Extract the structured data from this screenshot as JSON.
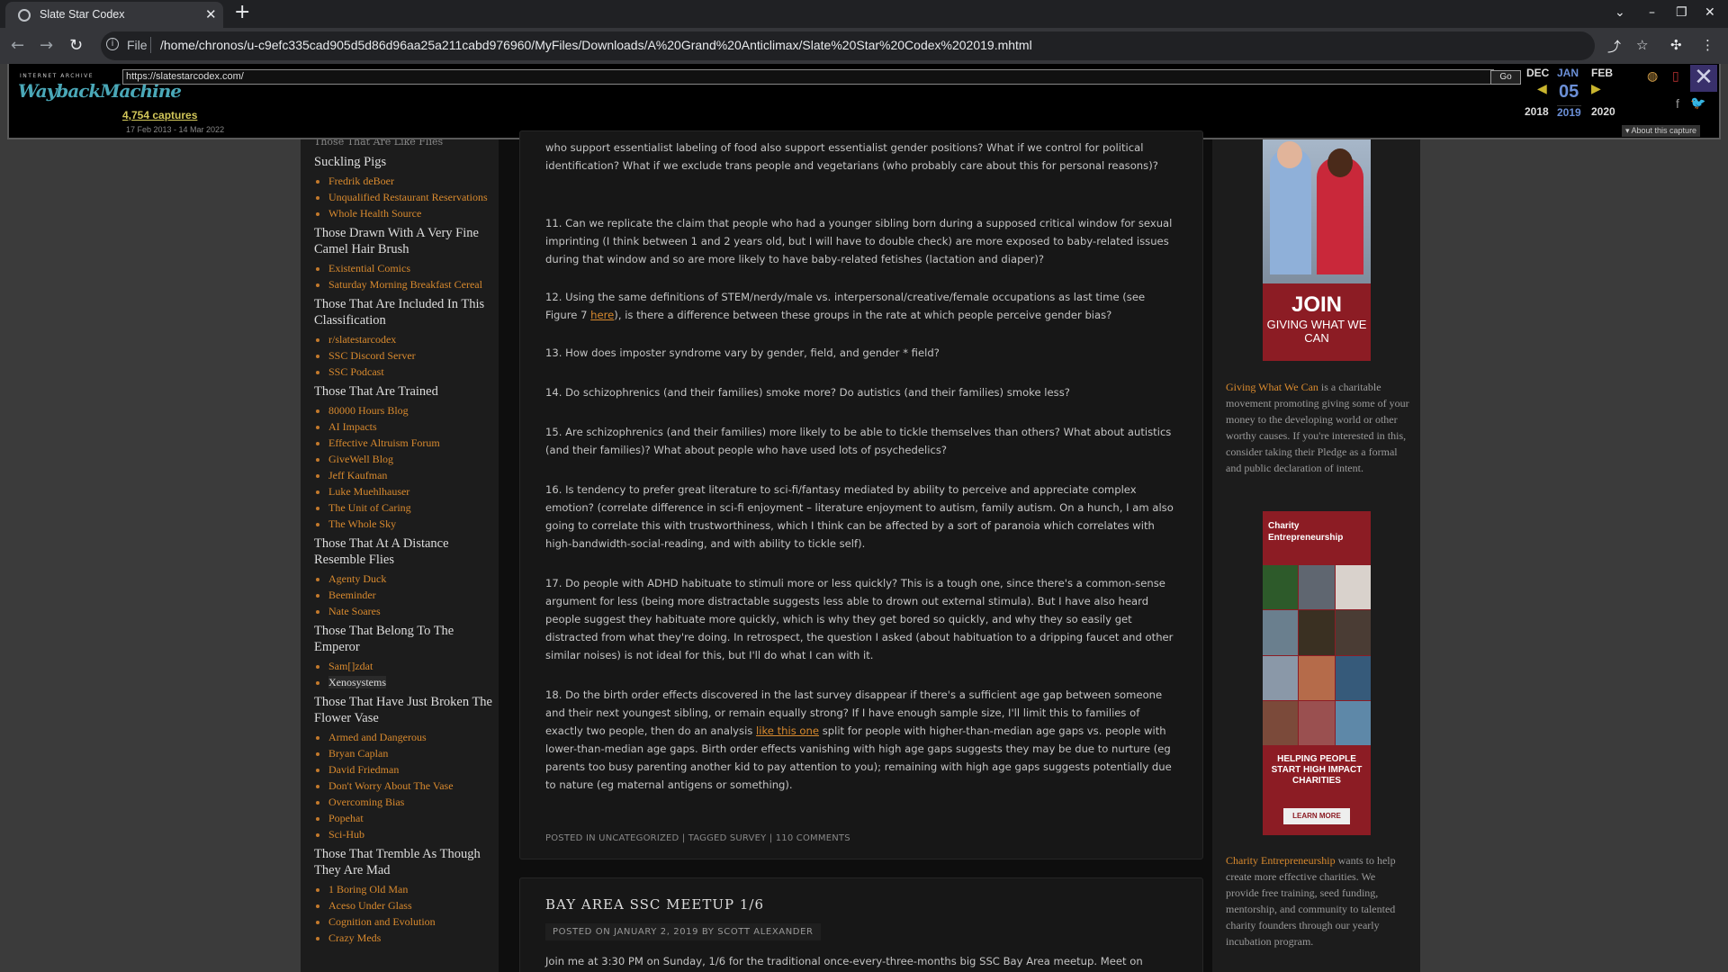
{
  "browser": {
    "tab_title": "Slate Star Codex",
    "url_scheme": "File",
    "url": "/home/chronos/u-c9efc335cad905d5d86d96aa25a211cabd976960/MyFiles/Downloads/A%20Grand%20Anticlimax/Slate%20Star%20Codex%202019.mhtml"
  },
  "wayback": {
    "logo_top": "INTERNET ARCHIVE",
    "logo": "WaybackMachine",
    "url": "https://slatestarcodex.com/",
    "go": "Go",
    "captures": "4,754 captures",
    "range": "17 Feb 2013 - 14 Mar 2022",
    "prev_month": "DEC",
    "cur_month": "JAN",
    "next_month": "FEB",
    "day": "05",
    "prev_year": "2018",
    "cur_year": "2019",
    "next_year": "2020",
    "about": "▾ About this capture",
    "facebook": "f"
  },
  "sidebar": {
    "cut_text": "Those That Are Like Flies",
    "groups": [
      {
        "heading": "Suckling Pigs",
        "items": [
          "Fredrik deBoer",
          "Unqualified Restaurant Reservations",
          "Whole Health Source"
        ]
      },
      {
        "heading": "Those Drawn With A Very Fine Camel Hair Brush",
        "items": [
          "Existential Comics",
          "Saturday Morning Breakfast Cereal"
        ]
      },
      {
        "heading": "Those That Are Included In This Classification",
        "items": [
          "r/slatestarcodex",
          "SSC Discord Server",
          "SSC Podcast"
        ]
      },
      {
        "heading": "Those That Are Trained",
        "items": [
          "80000 Hours Blog",
          "AI Impacts",
          "Effective Altruism Forum",
          "GiveWell Blog",
          "Jeff Kaufman",
          "Luke Muehlhauser",
          "The Unit of Caring",
          "The Whole Sky"
        ]
      },
      {
        "heading": "Those That At A Distance Resemble Flies",
        "items": [
          "Agenty Duck",
          "Beeminder",
          "Nate Soares"
        ]
      },
      {
        "heading": "Those That Belong To The Emperor",
        "items": [
          "Sam[]zdat",
          "Xenosystems"
        ]
      },
      {
        "heading": "Those That Have Just Broken The Flower Vase",
        "items": [
          "Armed and Dangerous",
          "Bryan Caplan",
          "David Friedman",
          "Don't Worry About The Vase",
          "Overcoming Bias",
          "Popehat",
          "Sci-Hub"
        ]
      },
      {
        "heading": "Those That Tremble As Though They Are Mad",
        "items": [
          "1 Boring Old Man",
          "Aceso Under Glass",
          "Cognition and Evolution",
          "Crazy Meds"
        ]
      }
    ]
  },
  "post1": {
    "p_top": "who support essentialist labeling of food also support essentialist gender positions? What if we control for political identification? What if we exclude trans people and vegetarians (who probably care about this for personal reasons)?",
    "p11": "11. Can we replicate the claim that people who had a younger sibling born during a supposed critical window for sexual imprinting (I think between 1 and 2 years old, but I will have to double check) are more exposed to baby-related issues during that window and so are more likely to have baby-related fetishes (lactation and diaper)?",
    "p12_a": "12. Using the same definitions of STEM/nerdy/male vs. interpersonal/creative/female occupations as last time (see Figure 7 ",
    "p12_link": "here",
    "p12_b": "), is there a difference between these groups in the rate at which people perceive gender bias?",
    "p13": "13. How does imposter syndrome vary by gender, field, and gender * field?",
    "p14": "14. Do schizophrenics (and their families) smoke more? Do autistics (and their families) smoke less?",
    "p15": "15. Are schizophrenics (and their families) more likely to be able to tickle themselves than others? What about autistics (and their families)? What about people who have used lots of psychedelics?",
    "p16": "16. Is tendency to prefer great literature to sci-fi/fantasy mediated by ability to perceive and appreciate complex emotion? (correlate difference in sci-fi enjoyment – literature enjoyment to autism, family autism. On a hunch, I am also going to correlate this with trustworthiness, which I think can be affected by a sort of paranoia which correlates with high-bandwidth-social-reading, and with ability to tickle self).",
    "p17": "17. Do people with ADHD habituate to stimuli more or less quickly? This is a tough one, since there's a common-sense argument for less (being more distractable suggests less able to drown out external stimula). But I have also heard people suggest they habituate more quickly, which is why they get bored so quickly, and why they so easily get distracted from what they're doing. In retrospect, the question I asked (about habituation to a dripping faucet and other similar noises) is not ideal for this, but I'll do what I can with it.",
    "p18_a": "18. Do the birth order effects discovered in the last survey disappear if there's a sufficient age gap between someone and their next youngest sibling, or remain equally strong? If I have enough sample size, I'll limit this to families of exactly two people, then do an analysis ",
    "p18_link": "like this one",
    "p18_b": " split for people with higher-than-median age gaps vs. people with lower-than-median age gaps. Birth order effects vanishing with high age gaps suggests they may be due to nurture (eg parents too busy parenting another kid to pay attention to you); remaining with high age gaps suggests potentially due to nature (eg maternal antigens or something).",
    "meta_posted": "POSTED IN ",
    "meta_cat": "UNCATEGORIZED",
    "meta_tagged": " | TAGGED ",
    "meta_tag": "SURVEY",
    "meta_sep": " | ",
    "meta_comments": "110 COMMENTS"
  },
  "post2": {
    "title": "BAY AREA SSC MEETUP 1/6",
    "meta": "POSTED ON JANUARY 2, 2019 BY SCOTT ALEXANDER",
    "text": "Join me at 3:30 PM on Sunday, 1/6 for the traditional once-every-three-months big SSC Bay Area meetup. Meet on"
  },
  "rightbar": {
    "ad1_join": "JOIN",
    "ad1_sub": "GIVING WHAT WE CAN",
    "gwc_link": "Giving What We Can",
    "gwc_text": " is a charitable movement promoting giving some of your money to the developing world or other worthy causes. If you're interested in this, consider taking their Pledge as a formal and public declaration of intent.",
    "ad2_head": "Charity Entrepreneurship",
    "ad2_bottom": "HELPING PEOPLE START HIGH IMPACT CHARITIES",
    "ad2_learn": "LEARN MORE",
    "ce_link": "Charity Entrepreneurship",
    "ce_text": " wants to help create more effective charities. We provide free training, seed funding, mentorship, and community to talented charity founders through our yearly incubation program."
  }
}
